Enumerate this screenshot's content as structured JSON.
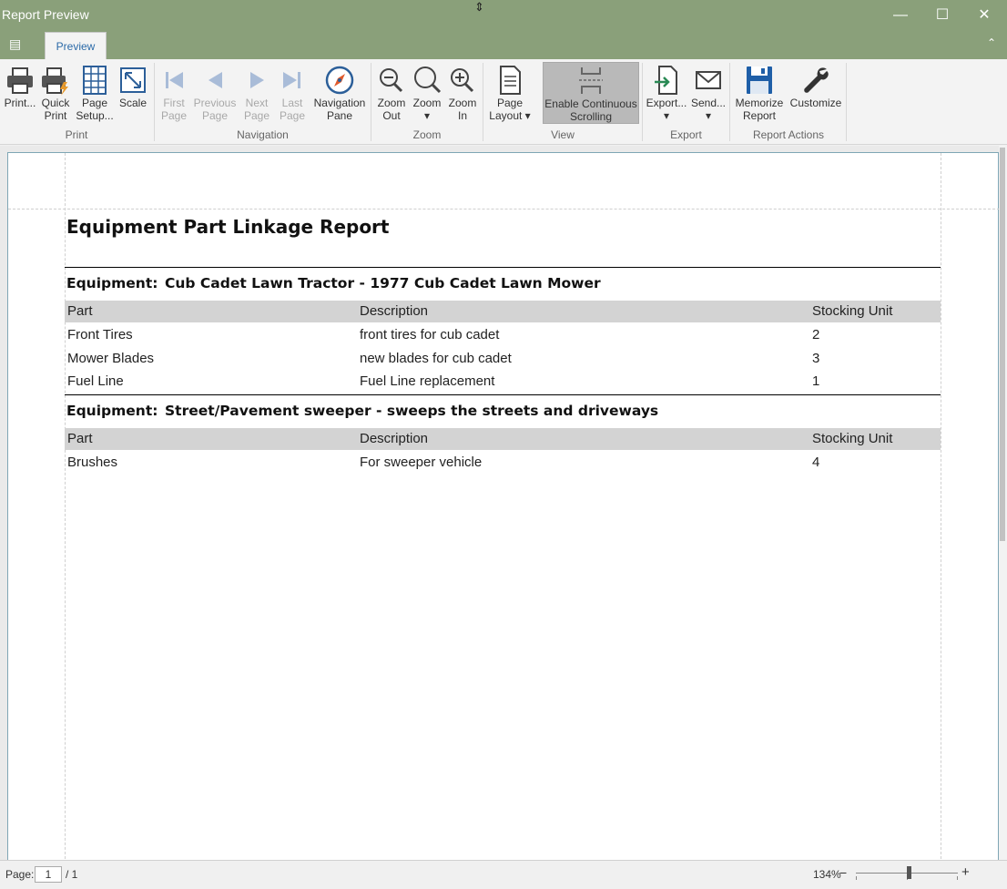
{
  "window": {
    "title": "Report Preview",
    "minimize": "—",
    "maximize": "☐",
    "close": "✕"
  },
  "tabs": {
    "app_menu": "▤",
    "preview": "Preview",
    "collapse": "⌃"
  },
  "ribbon": {
    "print": "Print...",
    "quick_print": "Quick\nPrint",
    "page_setup": "Page\nSetup...",
    "scale": "Scale",
    "first_page": "First\nPage",
    "previous_page": "Previous\nPage",
    "next_page": "Next\nPage",
    "last_page": "Last\nPage",
    "navigation_pane": "Navigation\nPane",
    "zoom_out": "Zoom\nOut",
    "zoom": "Zoom\n▾",
    "zoom_in": "Zoom\nIn",
    "page_layout": "Page\nLayout ▾",
    "continuous_scrolling": "Enable Continuous\nScrolling",
    "export": "Export...\n▾",
    "send": "Send...\n▾",
    "memorize_report": "Memorize\nReport",
    "customize": "Customize",
    "groups": {
      "print": "Print",
      "navigation": "Navigation",
      "zoom": "Zoom",
      "view": "View",
      "export": "Export",
      "report_actions": "Report Actions"
    }
  },
  "report": {
    "title": "Equipment Part Linkage Report",
    "equipment_label": "Equipment:",
    "columns": {
      "part": "Part",
      "description": "Description",
      "stocking_unit": "Stocking Unit"
    },
    "groups": [
      {
        "equipment": "Cub Cadet Lawn Tractor - 1977 Cub Cadet Lawn Mower",
        "rows": [
          {
            "part": "Front Tires",
            "description": "front tires for cub cadet",
            "unit": "2"
          },
          {
            "part": "Mower Blades",
            "description": "new blades for cub cadet",
            "unit": "3"
          },
          {
            "part": "Fuel Line",
            "description": "Fuel Line replacement",
            "unit": "1"
          }
        ]
      },
      {
        "equipment": "Street/Pavement sweeper - sweeps the streets and driveways",
        "rows": [
          {
            "part": "Brushes",
            "description": "For sweeper vehicle",
            "unit": "4"
          }
        ]
      }
    ]
  },
  "status": {
    "page_label": "Page:",
    "page_current": "1",
    "page_total": "/ 1",
    "zoom_level": "134%",
    "zoom_minus": "−",
    "zoom_plus": "+"
  },
  "colors": {
    "title_bar": "#8aa07a",
    "accent": "#2b6aa8",
    "header_band": "#d3d3d3"
  }
}
